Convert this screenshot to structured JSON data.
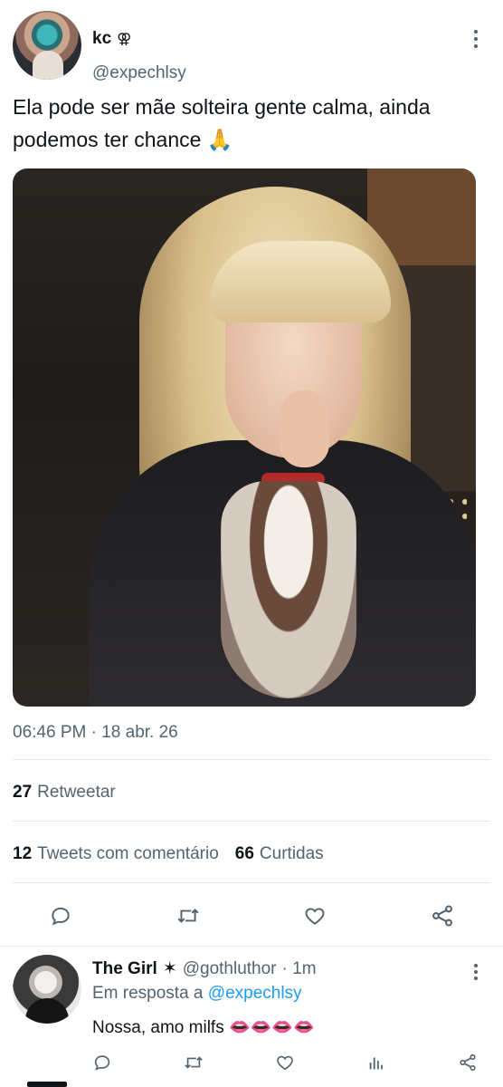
{
  "tweet": {
    "display_name": "kc",
    "name_symbol": "⚢",
    "handle": "@expechlsy",
    "text": "Ela pode ser mãe solteira gente calma, ainda podemos ter chance 🙏",
    "timestamp": "06:46 PM · 18 abr. 26",
    "media_icon": "photo"
  },
  "stats": {
    "retweets_count": "27",
    "retweets_label": "Retweetar",
    "quotes_count": "12",
    "quotes_label": "Tweets com comentário",
    "likes_count": "66",
    "likes_label": "Curtidas"
  },
  "actions": {
    "icons": [
      "reply-icon",
      "retweet-icon",
      "like-icon",
      "share-icon"
    ]
  },
  "reply": {
    "display_name": "The Girl",
    "name_symbol": "✶",
    "handle": "@gothluthor",
    "time": "· 1m",
    "in_reply_prefix": "Em resposta a",
    "in_reply_handle": "@expechlsy",
    "text": "Nossa, amo milfs 👄👄👄👄",
    "icons": [
      "reply-icon",
      "retweet-icon",
      "like-icon",
      "analytics-icon",
      "share-icon"
    ]
  },
  "colors": {
    "text_primary": "#0f1419",
    "text_secondary": "#536471",
    "link": "#1d9bf0",
    "divider": "#e6e9ec"
  }
}
